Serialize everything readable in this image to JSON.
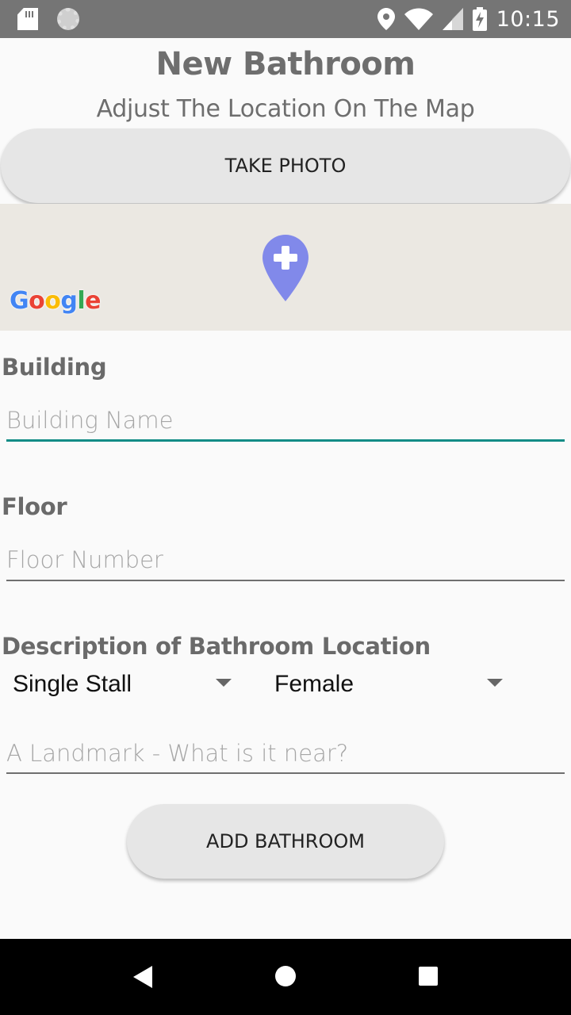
{
  "status_bar": {
    "time": "10:15",
    "left_icons": [
      "sd-card-icon",
      "loader-icon"
    ],
    "right_icons": [
      "location-icon",
      "wifi-icon",
      "signal-icon",
      "battery-charging-icon"
    ]
  },
  "header": {
    "title": "New Bathroom",
    "subtitle": "Adjust The Location On The Map"
  },
  "buttons": {
    "take_photo": "TAKE PHOTO",
    "add_bathroom": "ADD BATHROOM"
  },
  "map": {
    "logo": [
      "G",
      "o",
      "o",
      "g",
      "l",
      "e"
    ],
    "logo_colors": [
      "#4285F4",
      "#EA4335",
      "#FBBC05",
      "#4285F4",
      "#34A853",
      "#EA4335"
    ],
    "pin_color": "#8189ea"
  },
  "form": {
    "building_label": "Building",
    "building_placeholder": "Building Name",
    "floor_label": "Floor",
    "floor_placeholder": "Floor Number",
    "description_label": "Description of Bathroom Location",
    "stall_type": "Single Stall",
    "gender": "Female",
    "landmark_placeholder": "A Landmark - What is it near?"
  },
  "colors": {
    "accent": "#128c86",
    "status_bar": "#757575",
    "button_bg": "#e6e6e6"
  }
}
